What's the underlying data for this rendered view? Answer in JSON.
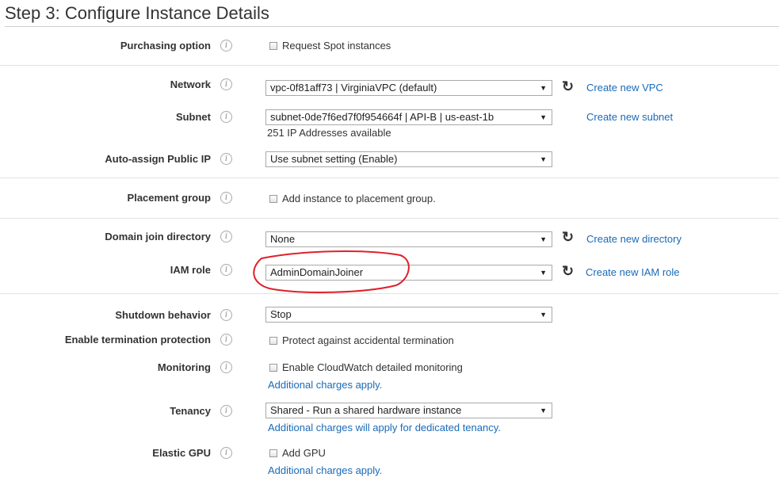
{
  "page": {
    "title": "Step 3: Configure Instance Details"
  },
  "purchasing": {
    "label": "Purchasing option",
    "checkbox_label": "Request Spot instances"
  },
  "network": {
    "label": "Network",
    "value": "vpc-0f81aff73 | VirginiaVPC (default)",
    "create_link": "Create new VPC"
  },
  "subnet": {
    "label": "Subnet",
    "value": "subnet-0de7f6ed7f0f954664f | API-B | us-east-1b",
    "note": "251 IP Addresses available",
    "create_link": "Create new subnet"
  },
  "public_ip": {
    "label": "Auto-assign Public IP",
    "value": "Use subnet setting (Enable)"
  },
  "placement": {
    "label": "Placement group",
    "checkbox_label": "Add instance to placement group."
  },
  "domain": {
    "label": "Domain join directory",
    "value": "None",
    "create_link": "Create new directory"
  },
  "iam": {
    "label": "IAM role",
    "value": "AdminDomainJoiner",
    "create_link": "Create new IAM role"
  },
  "shutdown": {
    "label": "Shutdown behavior",
    "value": "Stop"
  },
  "termination": {
    "label": "Enable termination protection",
    "checkbox_label": "Protect against accidental termination"
  },
  "monitoring": {
    "label": "Monitoring",
    "checkbox_label": "Enable CloudWatch detailed monitoring",
    "note_link": "Additional charges apply."
  },
  "tenancy": {
    "label": "Tenancy",
    "value": "Shared - Run a shared hardware instance",
    "note_link": "Additional charges will apply for dedicated tenancy."
  },
  "gpu": {
    "label": "Elastic GPU",
    "checkbox_label": "Add GPU",
    "note_link": "Additional charges apply."
  },
  "icons": {
    "info": "info-icon",
    "refresh": "refresh-icon",
    "dropdown": "dropdown-arrow-icon"
  },
  "colors": {
    "link": "#1a6ab8",
    "annotation": "#e0202a"
  }
}
